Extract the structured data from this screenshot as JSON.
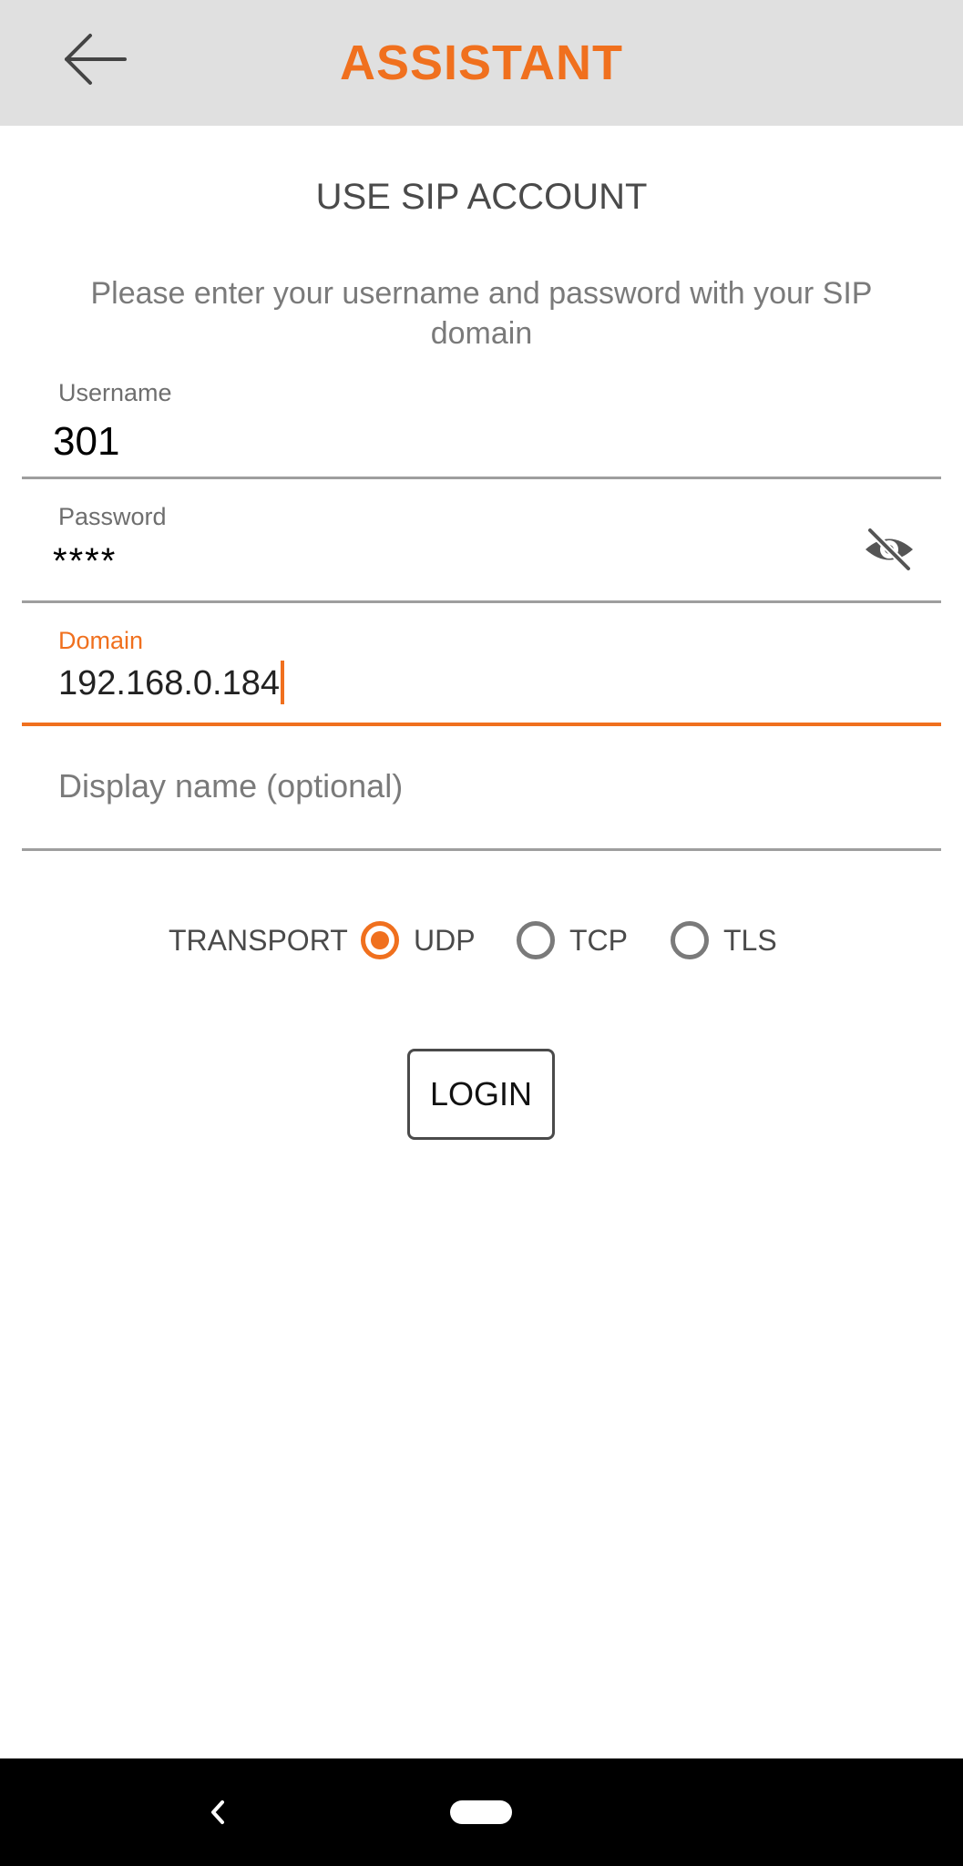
{
  "header": {
    "title": "ASSISTANT",
    "back_icon": "arrow-left-icon"
  },
  "main": {
    "section_title": "USE SIP ACCOUNT",
    "instructions": "Please enter your username and password with your SIP domain",
    "username": {
      "label": "Username",
      "value": "301"
    },
    "password": {
      "label": "Password",
      "value": "****",
      "visibility_icon": "eye-off-icon"
    },
    "domain": {
      "label": "Domain",
      "value": "192.168.0.184"
    },
    "display_name": {
      "placeholder": "Display name (optional)",
      "value": ""
    },
    "transport": {
      "label": "TRANSPORT",
      "options": [
        "UDP",
        "TCP",
        "TLS"
      ],
      "selected": "UDP"
    },
    "login_label": "LOGIN"
  },
  "colors": {
    "accent": "#f0701e",
    "topbar": "#e0e0e0",
    "navbar": "#000000"
  },
  "navbar": {
    "back_icon": "chevron-left-icon",
    "home_icon": "home-pill-icon"
  }
}
